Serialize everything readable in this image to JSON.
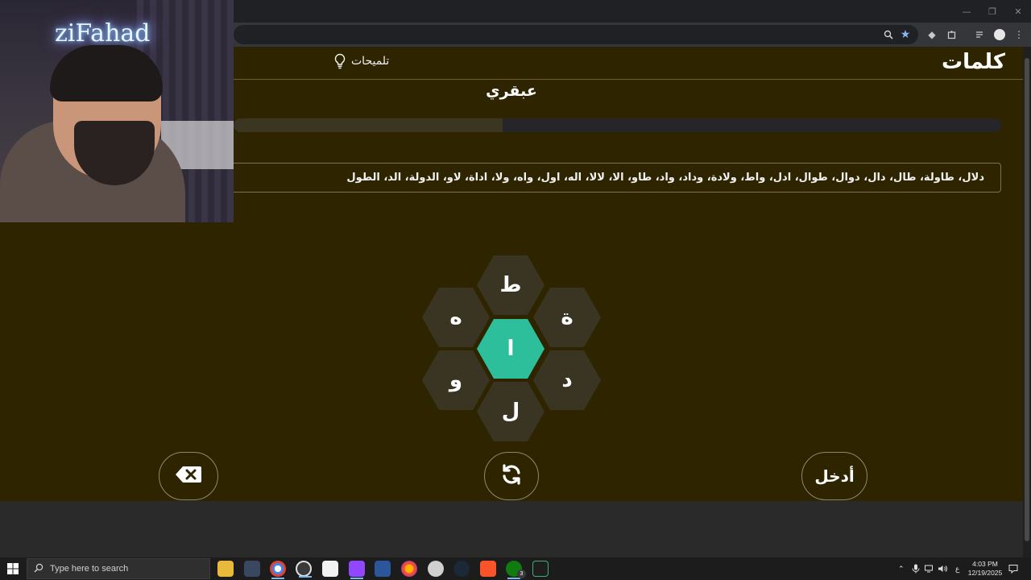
{
  "game": {
    "logo": "كلمات",
    "hints_label": "تلميحات",
    "rank": "عبقري",
    "progress": 0.35,
    "found_words": "دلال، طاولة، طال، دال، دوال، طوال، ادل، واط، ولادة، وداد، واد، طاو، الا، لالا، اله، اول، واه، ولا، اداة، لاو، الدولة، الد، الطول",
    "letters": {
      "top": "ط",
      "upper_left": "ه",
      "upper_right": "ة",
      "center": "ا",
      "lower_left": "و",
      "lower_right": "د",
      "bottom": "ل"
    },
    "enter_label": "أدخل"
  },
  "overlay": {
    "channel_name": "ziFahad"
  },
  "taskbar": {
    "search_placeholder": "Type here to search",
    "time": "4:03 PM",
    "date": "12/19/2025",
    "lang": "ع",
    "xbox_badge": "3"
  }
}
